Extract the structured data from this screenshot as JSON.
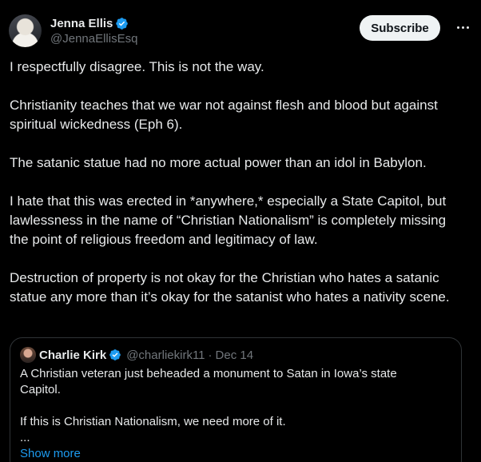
{
  "author": {
    "name": "Jenna Ellis",
    "handle": "@JennaEllisEsq"
  },
  "actions": {
    "subscribe_label": "Subscribe"
  },
  "tweet": {
    "paragraphs": [
      "I respectfully disagree. This is not the way.",
      "Christianity teaches that we war not against flesh and blood but against spiritual wickedness (Eph 6).",
      "The satanic statue had no more actual power than an idol in Babylon.",
      "I hate that this was erected in *anywhere,* especially a State Capitol, but lawlessness in the name of “Christian Nationalism” is completely missing the point of religious freedom and legitimacy of law.",
      "Destruction of property is not okay for the Christian who hates a satanic statue any more than it’s okay for the satanist who hates a nativity scene."
    ]
  },
  "quoted": {
    "name": "Charlie Kirk",
    "handle": "@charliekirk11",
    "separator": "·",
    "date": "Dec 14",
    "paragraphs": [
      "A Christian veteran just beheaded a monument to Satan in Iowa’s state Capitol.",
      "If this is Christian Nationalism, we need more of it.",
      "..."
    ],
    "show_more_label": "Show more"
  },
  "colors": {
    "background": "#000000",
    "text": "#e7e9ea",
    "secondary": "#71767b",
    "link": "#1d9bf0",
    "verified": "#1d9bf0",
    "border": "#2f3336"
  },
  "icons": {
    "verified": "verified-badge-icon",
    "more": "more-horizontal-icon"
  }
}
